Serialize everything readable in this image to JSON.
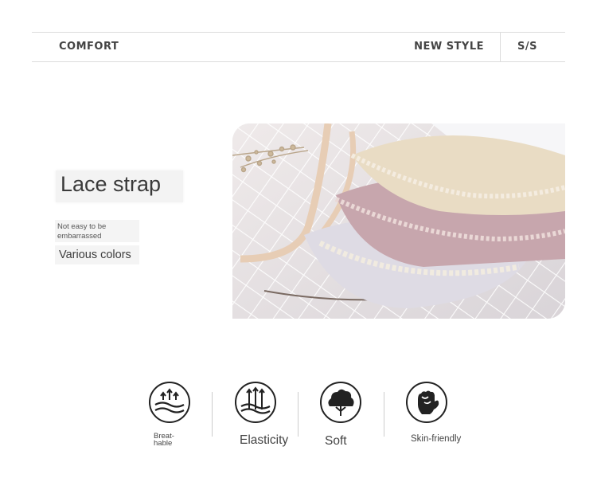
{
  "header": {
    "left_label": "COMFORT",
    "right_label": "NEW STYLE",
    "season_label": "S/S"
  },
  "product": {
    "title": "Lace strap",
    "note": "Not easy to be embarrassed",
    "colors_text": "Various colors"
  },
  "features": [
    {
      "label": "Breat-\nhable",
      "icon": "breathable-icon"
    },
    {
      "label": "Elasticity",
      "icon": "elasticity-icon"
    },
    {
      "label": "Soft",
      "icon": "soft-cloud-icon"
    },
    {
      "label": "Skin-friendly",
      "icon": "skin-friendly-hand-icon"
    }
  ],
  "colors": {
    "text_dark": "#333333",
    "divider": "#dcdcdc",
    "icon_stroke": "#222222"
  }
}
